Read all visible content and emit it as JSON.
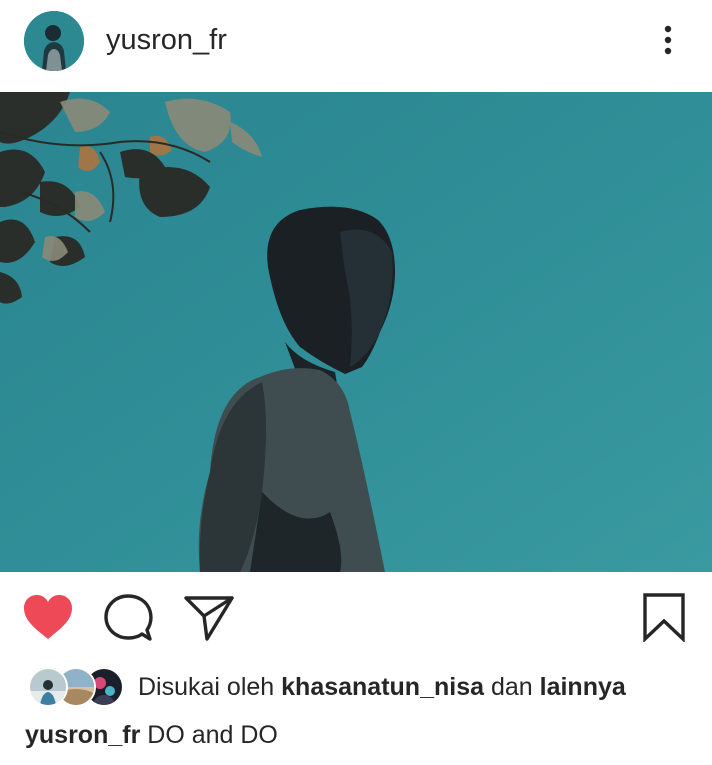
{
  "post": {
    "username": "yusron_fr",
    "likes_prefix": "Disukai oleh",
    "likes_user": "khasanatun_nisa",
    "likes_joiner": "dan",
    "likes_others": "lainnya",
    "caption_user": "yusron_fr",
    "caption_text": "DO and DO"
  },
  "icons": {
    "menu": "more-vertical-icon",
    "like": "heart-icon",
    "comment": "comment-bubble-icon",
    "share": "paper-plane-icon",
    "save": "bookmark-icon"
  },
  "colors": {
    "like_active": "#ed4956",
    "text": "#262626",
    "sky": "#2f8c95"
  }
}
